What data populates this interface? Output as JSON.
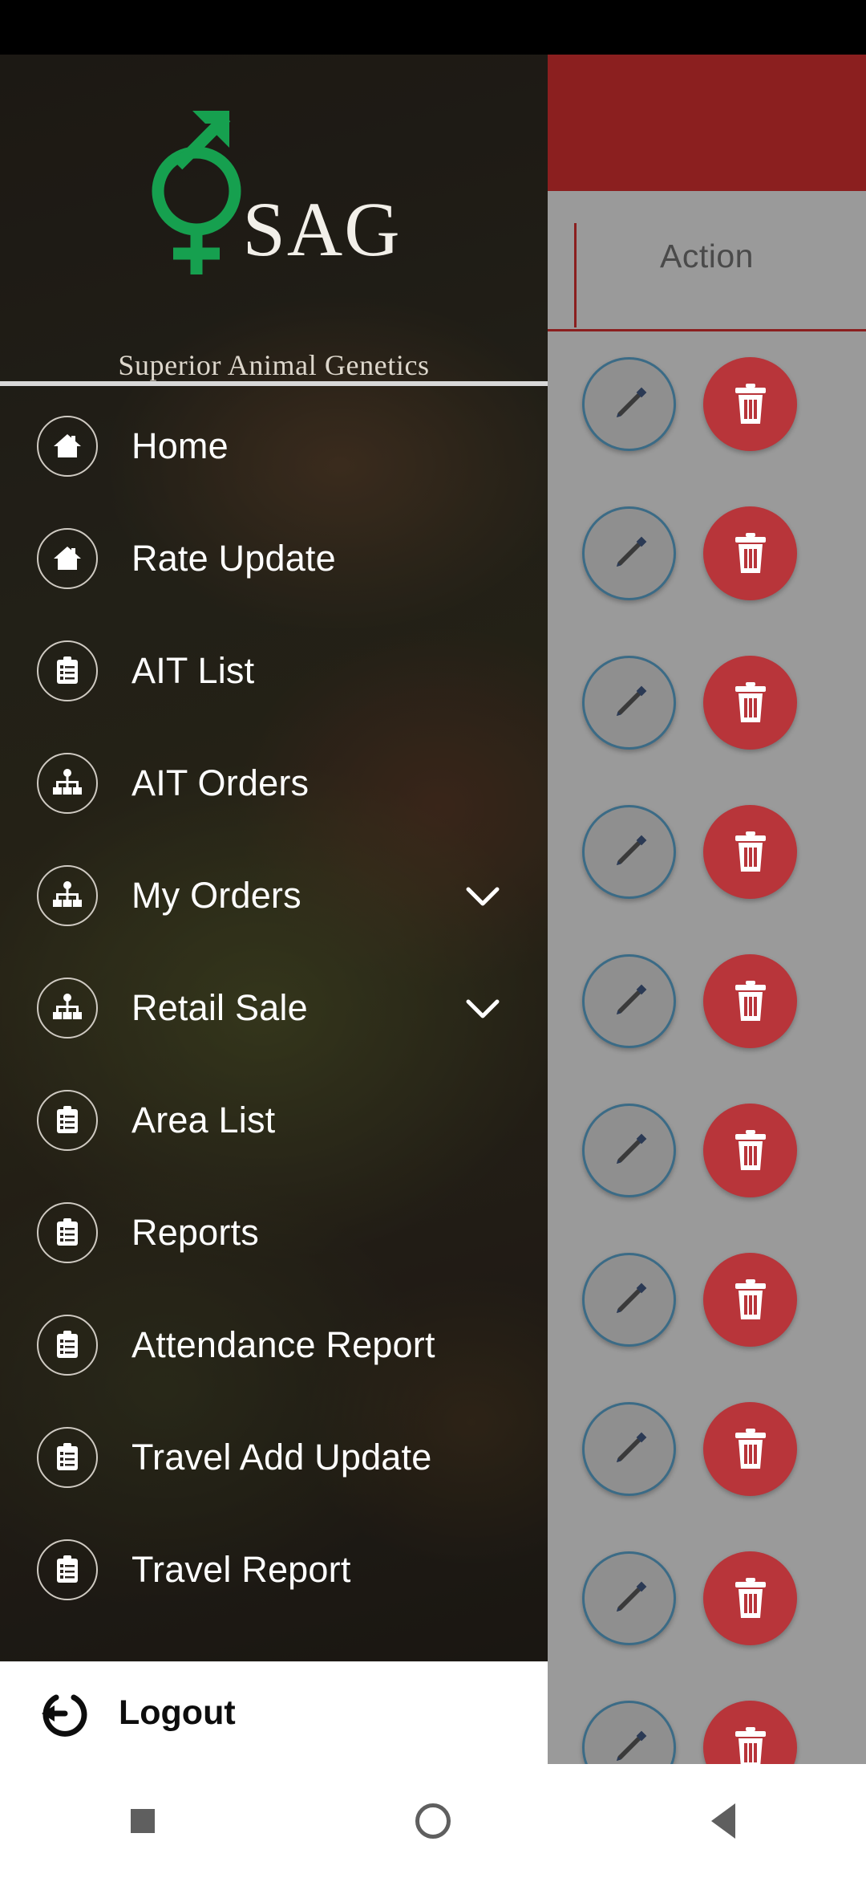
{
  "app": {
    "brand_name": "SAG",
    "tagline": "Superior Animal Genetics",
    "accent_green": "#16A04F",
    "accent_red": "#8B1F1F",
    "delete_red": "#B8353A",
    "edit_blue": "#3B6B86"
  },
  "drawer": {
    "logo_icon": "gender-combined-icon",
    "items": [
      {
        "label": "Home",
        "icon": "home-icon",
        "expandable": false
      },
      {
        "label": "Rate Update",
        "icon": "home-icon",
        "expandable": false
      },
      {
        "label": "AIT List",
        "icon": "clipboard-list-icon",
        "expandable": false
      },
      {
        "label": "AIT Orders",
        "icon": "sitemap-icon",
        "expandable": false
      },
      {
        "label": "My Orders",
        "icon": "sitemap-icon",
        "expandable": true
      },
      {
        "label": "Retail Sale",
        "icon": "sitemap-icon",
        "expandable": true
      },
      {
        "label": "Area List",
        "icon": "clipboard-list-icon",
        "expandable": false
      },
      {
        "label": "Reports",
        "icon": "clipboard-list-icon",
        "expandable": false
      },
      {
        "label": "Attendance Report",
        "icon": "clipboard-list-icon",
        "expandable": false
      },
      {
        "label": "Travel Add Update",
        "icon": "clipboard-list-icon",
        "expandable": false
      },
      {
        "label": "Travel Report",
        "icon": "clipboard-list-icon",
        "expandable": false
      }
    ],
    "logout": {
      "label": "Logout",
      "icon": "logout-icon"
    }
  },
  "table": {
    "column_header": "Action",
    "row_actions": {
      "edit_icon": "pencil-icon",
      "delete_icon": "trash-icon"
    },
    "rows": [
      {
        "edit": "edit",
        "delete": "delete"
      },
      {
        "edit": "edit",
        "delete": "delete"
      },
      {
        "edit": "edit",
        "delete": "delete"
      },
      {
        "edit": "edit",
        "delete": "delete"
      },
      {
        "edit": "edit",
        "delete": "delete"
      },
      {
        "edit": "edit",
        "delete": "delete"
      },
      {
        "edit": "edit",
        "delete": "delete"
      },
      {
        "edit": "edit",
        "delete": "delete"
      },
      {
        "edit": "edit",
        "delete": "delete"
      },
      {
        "edit": "edit",
        "delete": "delete"
      }
    ]
  },
  "navbar": {
    "recent": "recent-apps-icon",
    "home": "home-circle-icon",
    "back": "back-triangle-icon"
  }
}
